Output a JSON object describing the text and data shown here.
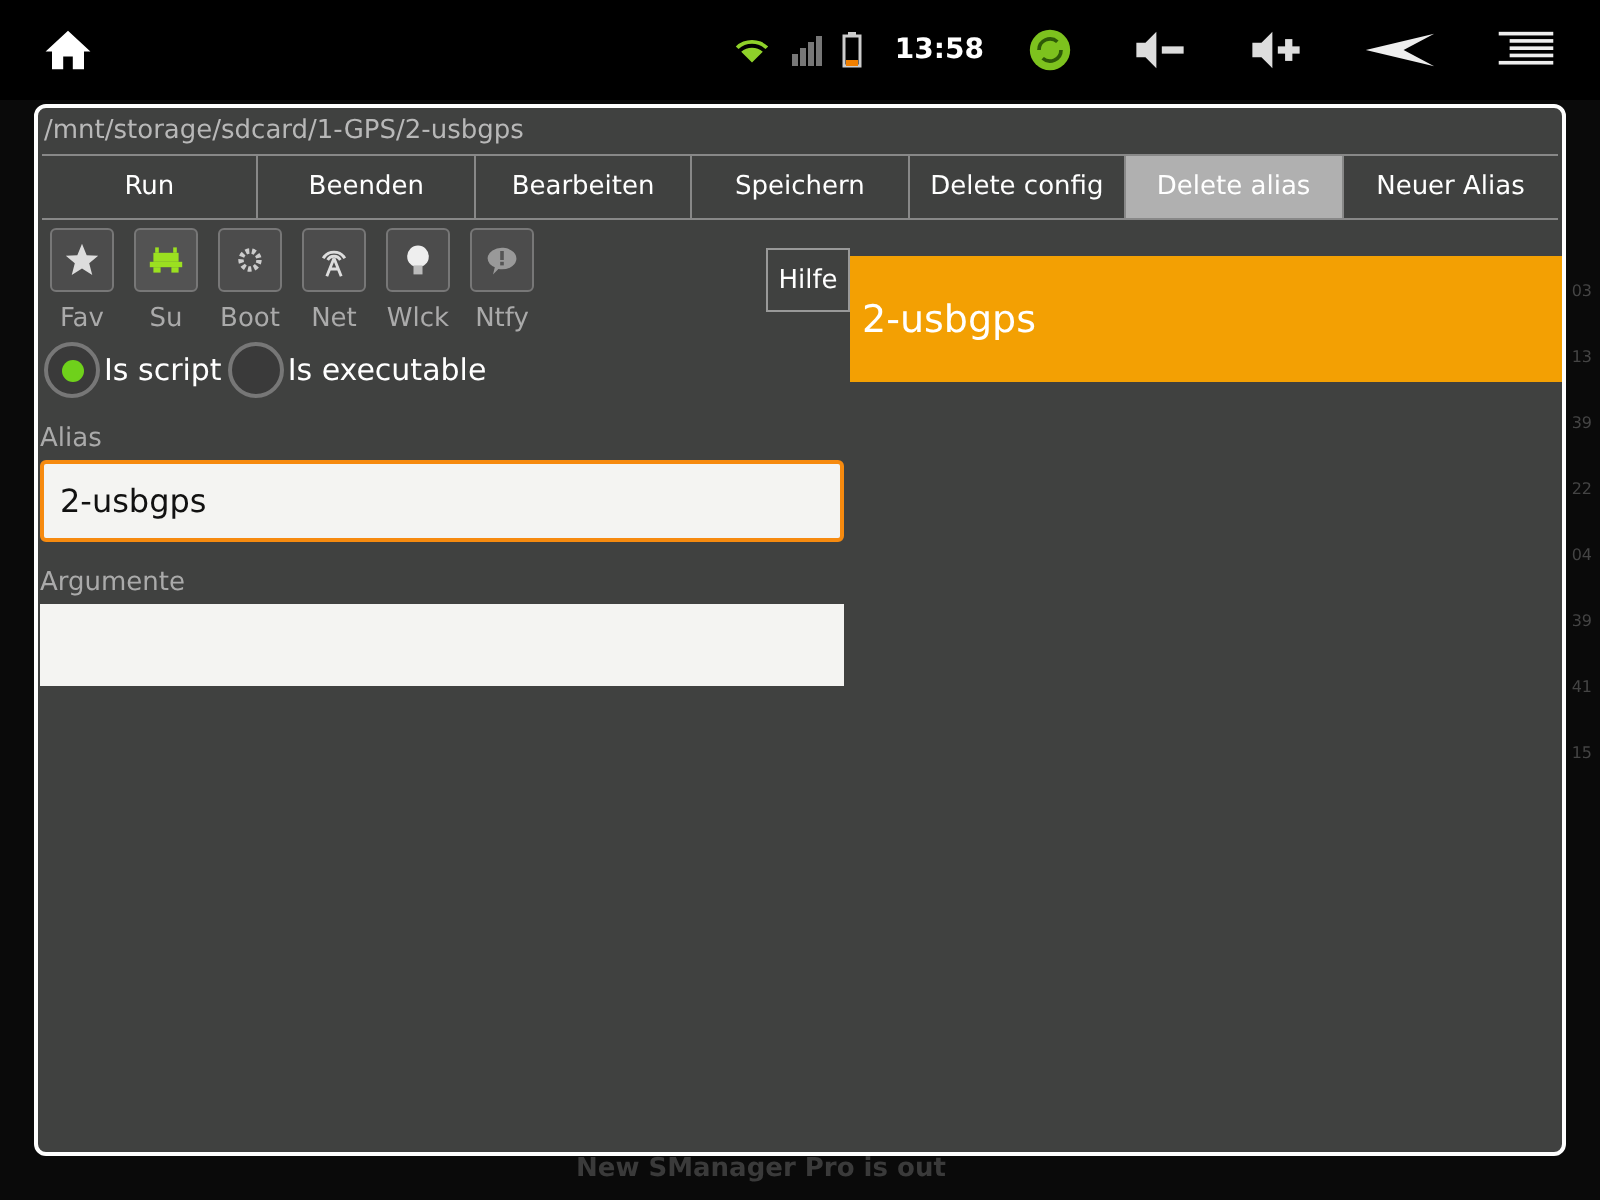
{
  "status_bar": {
    "time": "13:58"
  },
  "background": {
    "side_numbers": [
      "03",
      "13",
      "39",
      "22",
      "04",
      "39",
      "41",
      "15"
    ],
    "footer": "New SManager Pro is out"
  },
  "dialog": {
    "path": "/mnt/storage/sdcard/1-GPS/2-usbgps",
    "buttons": [
      {
        "label": "Run",
        "highlighted": false
      },
      {
        "label": "Beenden",
        "highlighted": false
      },
      {
        "label": "Bearbeiten",
        "highlighted": false
      },
      {
        "label": "Speichern",
        "highlighted": false
      },
      {
        "label": "Delete config",
        "highlighted": false
      },
      {
        "label": "Delete alias",
        "highlighted": true
      },
      {
        "label": "Neuer Alias",
        "highlighted": false
      }
    ],
    "toggles": [
      {
        "label": "Fav",
        "kind": "star",
        "on": false
      },
      {
        "label": "Su",
        "kind": "android",
        "on": true
      },
      {
        "label": "Boot",
        "kind": "gear",
        "on": false
      },
      {
        "label": "Net",
        "kind": "antenna",
        "on": false
      },
      {
        "label": "Wlck",
        "kind": "bulb",
        "on": false
      },
      {
        "label": "Ntfy",
        "kind": "bubble",
        "on": false
      }
    ],
    "help_button": "Hilfe",
    "radios": [
      {
        "label": "Is script",
        "selected": true
      },
      {
        "label": "Is executable",
        "selected": false
      }
    ],
    "alias": {
      "label": "Alias",
      "value": "2-usbgps",
      "focused": true
    },
    "arguments": {
      "label": "Argumente",
      "focused": false
    },
    "header": "2-usbgps"
  }
}
